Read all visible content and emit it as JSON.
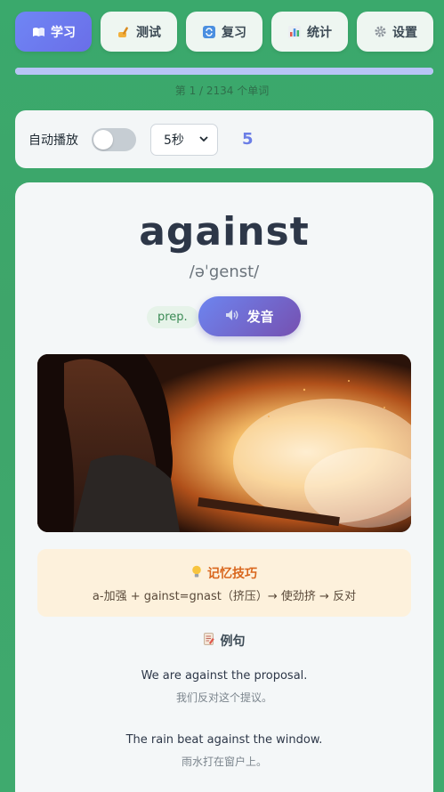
{
  "nav": {
    "items": [
      {
        "label": "学习",
        "icon": "book-icon",
        "active": true
      },
      {
        "label": "测试",
        "icon": "writing-hand-icon",
        "active": false
      },
      {
        "label": "复习",
        "icon": "repeat-icon",
        "active": false
      },
      {
        "label": "统计",
        "icon": "bar-chart-icon",
        "active": false
      },
      {
        "label": "设置",
        "icon": "gear-icon",
        "active": false
      }
    ]
  },
  "progress": {
    "text": "第 1 / 2134 个单词",
    "fraction": 1
  },
  "autoplay": {
    "label": "自动播放",
    "enabled": false,
    "interval_selected": "5秒",
    "countdown": "5"
  },
  "word": {
    "text": "against",
    "phonetic": "/əˈgenst/",
    "part_of_speech": "prep.",
    "speak_label": "发音",
    "speak_icon": "speaker-icon"
  },
  "memory": {
    "title": "记忆技巧",
    "icon": "lightbulb-icon",
    "text": "a-加强 + gainst=gnast（挤压）→ 使劲挤 → 反对"
  },
  "examples": {
    "title": "例句",
    "icon": "memo-icon",
    "items": [
      {
        "en": "We are against the proposal.",
        "zh": "我们反对这个提议。"
      },
      {
        "en": "The rain beat against the window.",
        "zh": "雨水打在窗户上。"
      }
    ]
  },
  "colors": {
    "background": "#3faa6e",
    "accent": "#6b7ee6",
    "memo_bg": "#fdf1dc",
    "memo_title": "#d9661c"
  }
}
